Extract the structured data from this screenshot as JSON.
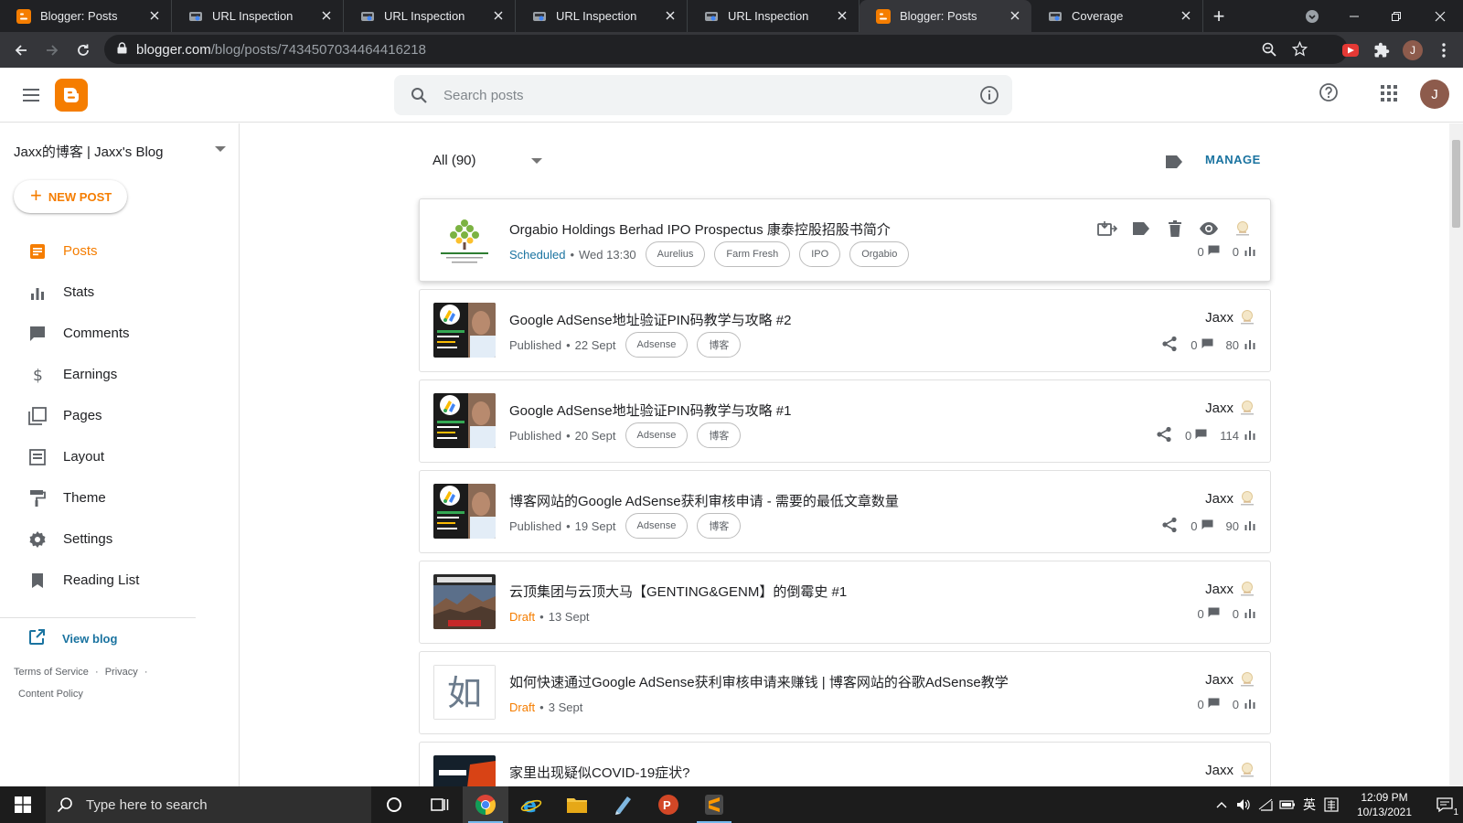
{
  "browser": {
    "tabs": [
      {
        "title": "Blogger: Posts",
        "favicon": "blogger",
        "active": false
      },
      {
        "title": "URL Inspection",
        "favicon": "search-console",
        "active": false
      },
      {
        "title": "URL Inspection",
        "favicon": "search-console",
        "active": false
      },
      {
        "title": "URL Inspection",
        "favicon": "search-console",
        "active": false
      },
      {
        "title": "URL Inspection",
        "favicon": "search-console",
        "active": false
      },
      {
        "title": "Blogger: Posts",
        "favicon": "blogger",
        "active": true
      },
      {
        "title": "Coverage",
        "favicon": "search-console",
        "active": false
      }
    ],
    "url_host": "blogger.com",
    "url_path": "/blog/posts/7434507034464416218",
    "profile_initial": "J"
  },
  "header": {
    "search_placeholder": "Search posts",
    "avatar_initial": "J"
  },
  "sidebar": {
    "blog_name": "Jaxx的博客 | Jaxx's Blog",
    "new_post_label": "NEW POST",
    "items": [
      {
        "label": "Posts",
        "icon": "posts-icon",
        "active": true
      },
      {
        "label": "Stats",
        "icon": "stats-icon",
        "active": false
      },
      {
        "label": "Comments",
        "icon": "comments-icon",
        "active": false
      },
      {
        "label": "Earnings",
        "icon": "dollar-icon",
        "active": false
      },
      {
        "label": "Pages",
        "icon": "pages-icon",
        "active": false
      },
      {
        "label": "Layout",
        "icon": "layout-icon",
        "active": false
      },
      {
        "label": "Theme",
        "icon": "paint-roller-icon",
        "active": false
      },
      {
        "label": "Settings",
        "icon": "gear-icon",
        "active": false
      },
      {
        "label": "Reading List",
        "icon": "bookmark-icon",
        "active": false
      }
    ],
    "view_blog_label": "View blog",
    "footer": {
      "terms": "Terms of Service",
      "privacy": "Privacy",
      "content_policy": "Content Policy",
      "sep": "·"
    }
  },
  "main": {
    "filter_label": "All (90)",
    "manage_label": "MANAGE",
    "posts": [
      {
        "title": "Orgabio Holdings Berhad IPO Prospectus 康泰控股招股书简介",
        "status": "Scheduled",
        "status_type": "scheduled",
        "date": "Wed 13:30",
        "labels": [
          "Aurelius",
          "Farm Fresh",
          "IPO",
          "Orgabio"
        ],
        "author": "",
        "comments": "0",
        "views": "0",
        "thumb": "orgabio"
      },
      {
        "title": "Google AdSense地址验证PIN码教学与攻略 #2",
        "status": "Published",
        "status_type": "published",
        "date": "22 Sept",
        "labels": [
          "Adsense",
          "博客"
        ],
        "author": "Jaxx",
        "comments": "0",
        "views": "80",
        "thumb": "adsense"
      },
      {
        "title": "Google AdSense地址验证PIN码教学与攻略 #1",
        "status": "Published",
        "status_type": "published",
        "date": "20 Sept",
        "labels": [
          "Adsense",
          "博客"
        ],
        "author": "Jaxx",
        "comments": "0",
        "views": "114",
        "thumb": "adsense"
      },
      {
        "title": "博客网站的Google AdSense获利审核申请 - 需要的最低文章数量",
        "status": "Published",
        "status_type": "published",
        "date": "19 Sept",
        "labels": [
          "Adsense",
          "博客"
        ],
        "author": "Jaxx",
        "comments": "0",
        "views": "90",
        "thumb": "adsense"
      },
      {
        "title": "云顶集团与云顶大马【GENTING&GENM】的倒霉史 #1",
        "status": "Draft",
        "status_type": "draft",
        "date": "13 Sept",
        "labels": [],
        "author": "Jaxx",
        "comments": "0",
        "views": "0",
        "thumb": "genting"
      },
      {
        "title": "如何快速通过Google AdSense获利审核申请来赚钱 | 博客网站的谷歌AdSense教学",
        "status": "Draft",
        "status_type": "draft",
        "date": "3 Sept",
        "labels": [],
        "author": "Jaxx",
        "comments": "0",
        "views": "0",
        "thumb": "ru"
      },
      {
        "title": "家里出现疑似COVID-19症状?",
        "status": "",
        "status_type": "draft",
        "date": "",
        "labels": [],
        "author": "Jaxx",
        "comments": "",
        "views": "",
        "thumb": "covid"
      }
    ],
    "thumb_glyph_ru": "如"
  },
  "taskbar": {
    "search_placeholder": "Type here to search",
    "ime_label": "英",
    "time": "12:09 PM",
    "date": "10/13/2021",
    "notification_count": "1"
  },
  "colors": {
    "brand": "#f57d00",
    "link": "#1a73a0",
    "chrome_dark": "#202124"
  }
}
